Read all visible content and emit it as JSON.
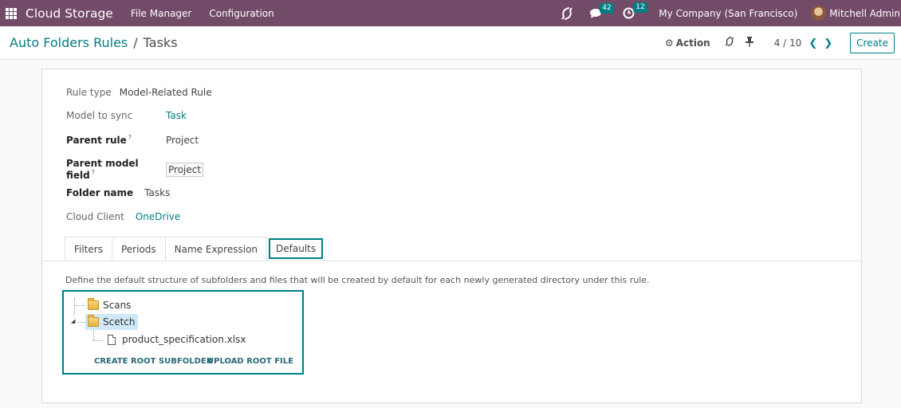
{
  "navbar": {
    "brand": "Cloud Storage",
    "menu": [
      "File Manager",
      "Configuration"
    ],
    "messages_count": "42",
    "activities_count": "12",
    "company": "My Company (San Francisco)",
    "user": "Mitchell Admin"
  },
  "control_panel": {
    "breadcrumb_parent": "Auto Folders Rules",
    "breadcrumb_sep": "/",
    "breadcrumb_current": "Tasks",
    "action_label": "Action",
    "pager": "4 / 10",
    "create_label": "Create"
  },
  "form": {
    "rule_type_label": "Rule type",
    "rule_type_value": "Model-Related Rule",
    "model_label": "Model to sync",
    "model_value": "Task",
    "parent_rule_label": "Parent rule",
    "parent_rule_value": "Project",
    "parent_field_label": "Parent model field",
    "parent_field_value": "Project",
    "help_mark": "?",
    "folder_name_label": "Folder name",
    "folder_name_value": "Tasks",
    "cloud_client_label": "Cloud Client",
    "cloud_client_value": "OneDrive"
  },
  "tabs": [
    "Filters",
    "Periods",
    "Name Expression",
    "Defaults"
  ],
  "defaults": {
    "description": "Define the default structure of subfolders and files that will be created by default for each newly generated directory under this rule.",
    "tree": {
      "folder1": "Scans",
      "folder2": "Scetch",
      "file1": "product_specification.xlsx"
    },
    "create_root_subfolder": "CREATE ROOT SUBFOLDER",
    "upload_root_file": "UPLOAD ROOT FILE"
  },
  "colors": {
    "navbar": "#714b67",
    "accent": "#017e84",
    "selected_node": "#cfe8f7"
  }
}
